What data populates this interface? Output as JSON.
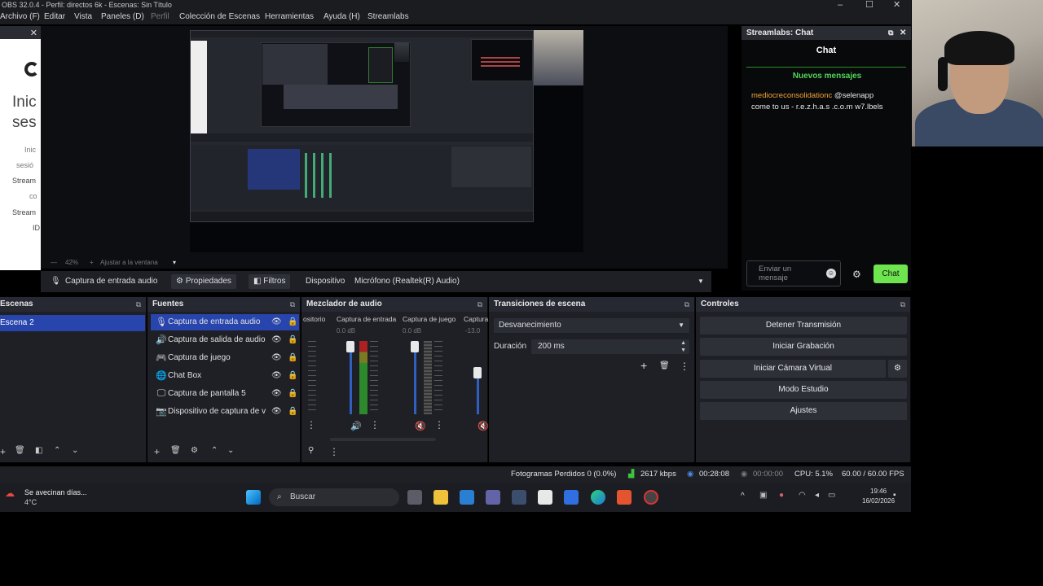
{
  "window": {
    "title": "OBS 32.0.4 - Perfil: directos 6k - Escenas: Sin Título",
    "controls": [
      "–",
      "☐",
      "✕"
    ]
  },
  "menu": [
    "Archivo (F)",
    "Editar",
    "Vista",
    "Paneles (D)",
    "Perfil",
    "Colección de Escenas",
    "Herramientas",
    "Ayuda (H)",
    "Streamlabs"
  ],
  "login_panel": {
    "big1": "Inic",
    "big2": "ses",
    "lines": [
      "Inic",
      "sesió",
      "Stream",
      "co",
      "Stream",
      "ID"
    ]
  },
  "preview": {
    "zoom": "42%",
    "fit_label": "Ajustar a la ventana"
  },
  "source_toolbar": {
    "source_name": "Captura de entrada audio",
    "properties": "Propiedades",
    "filters": "Filtros",
    "device_label": "Dispositivo",
    "device_value": "Micrófono (Realtek(R) Audio)"
  },
  "chat": {
    "dock_title": "Streamlabs: Chat",
    "title": "Chat",
    "new_messages": "Nuevos mensajes",
    "user": "mediocreconsolidationc",
    "mention": "@selenapp",
    "message": "come to us - r.e.z.h.a.s .c.o.m w7.lbels",
    "input_placeholder": "Enviar un mensaje",
    "send": "Chat",
    "colors": {
      "user": "#f2a33a",
      "send_bg": "#6ee44f",
      "new": "#53d65a"
    }
  },
  "scenes": {
    "title": "Escenas",
    "items": [
      "Escena 2"
    ]
  },
  "sources": {
    "title": "Fuentes",
    "items": [
      {
        "icon": "microphone-icon",
        "glyph": "🎙",
        "name": "Captura de entrada audio"
      },
      {
        "icon": "speaker-icon",
        "glyph": "🔊",
        "name": "Captura de salida de audio"
      },
      {
        "icon": "gamepad-icon",
        "glyph": "🎮",
        "name": "Captura de juego"
      },
      {
        "icon": "globe-icon",
        "glyph": "🌐",
        "name": "Chat Box"
      },
      {
        "icon": "monitor-icon",
        "glyph": "🖵",
        "name": "Captura de pantalla 5"
      },
      {
        "icon": "camera-icon",
        "glyph": "📷",
        "name": "Dispositivo de captura de v"
      }
    ]
  },
  "mixer": {
    "title": "Mezclador de audio",
    "channels": [
      {
        "name": "ositorio",
        "db": ""
      },
      {
        "name": "Captura de entrada",
        "db": "0.0 dB"
      },
      {
        "name": "Captura de juego",
        "db": "0.0 dB"
      },
      {
        "name": "Captura",
        "db": "-13.0"
      }
    ]
  },
  "transitions": {
    "title": "Transiciones de escena",
    "selected": "Desvanecimiento",
    "duration_label": "Duración",
    "duration_value": "200 ms"
  },
  "controls": {
    "title": "Controles",
    "buttons": [
      "Detener Transmisión",
      "Iniciar Grabación",
      "Iniciar Cámara Virtual",
      "Modo Estudio",
      "Ajustes"
    ]
  },
  "status": {
    "frames": "Fotogramas Perdidos 0 (0.0%)",
    "bitrate": "2617 kbps",
    "live_time": "00:28:08",
    "rec_time": "00:00:00",
    "cpu": "CPU: 5.1%",
    "fps": "60.00 / 60.00 FPS"
  },
  "taskbar": {
    "weather_text": "Se avecinan días...",
    "weather_temp": "4°C",
    "search": "Buscar",
    "time": "19:46",
    "date": "16/02/2026"
  }
}
